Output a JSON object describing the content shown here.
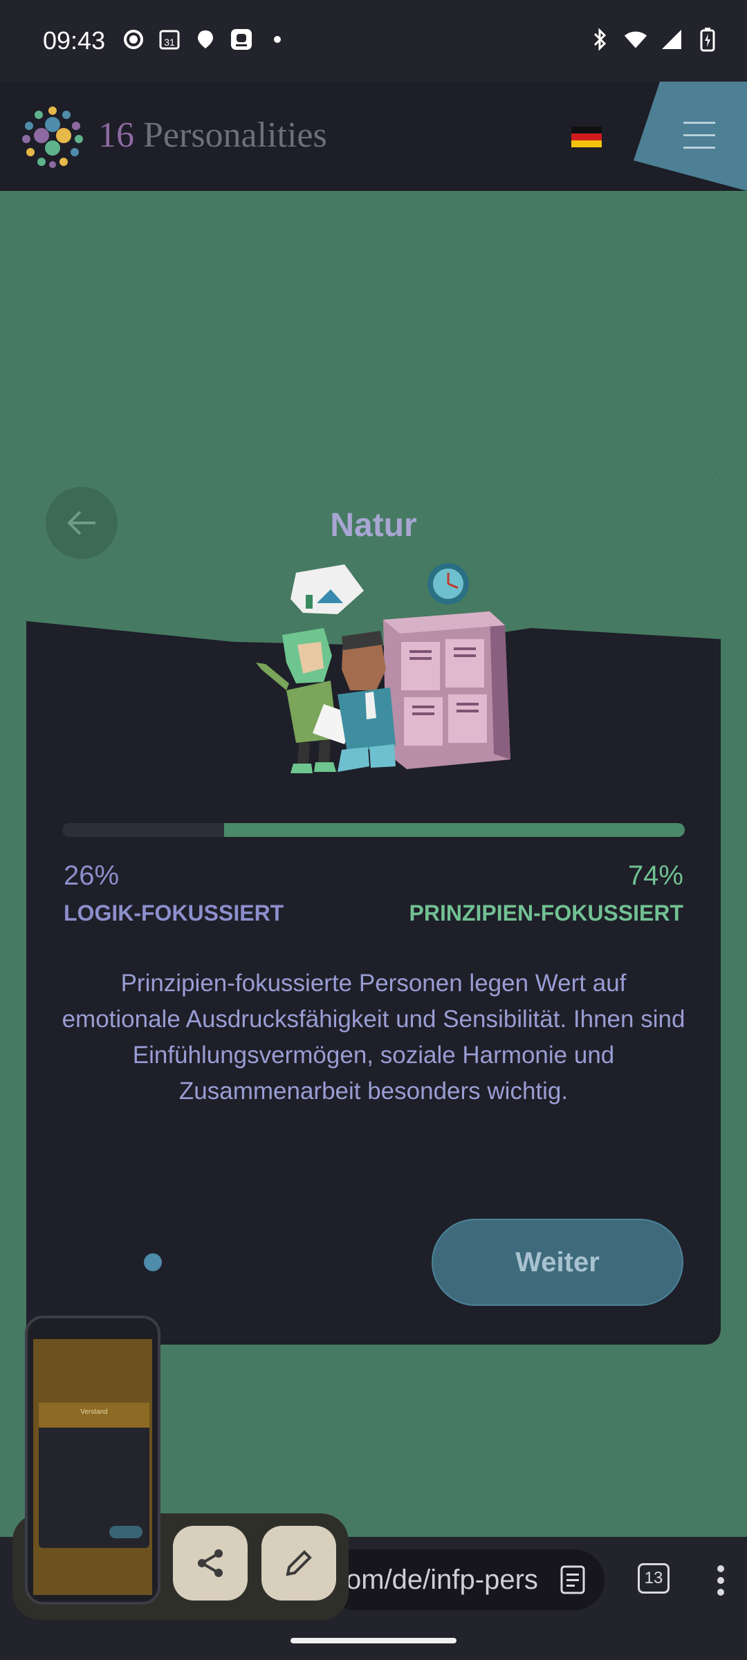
{
  "status_bar": {
    "time": "09:43",
    "left_icons": [
      "chat-bubble-icon",
      "calendar-icon",
      "maps-icon",
      "app-icon",
      "dot-icon"
    ],
    "calendar_day": "31",
    "right_icons": [
      "bluetooth-icon",
      "wifi-icon",
      "signal-icon",
      "battery-charging-icon"
    ]
  },
  "header": {
    "logo_number": "16",
    "logo_word": "Personalities",
    "language_flag": "flag-germany-icon",
    "menu_icon": "hamburger-icon"
  },
  "card": {
    "title": "Natur",
    "back_icon": "arrow-left-icon",
    "progress_fraction_right": 0.74,
    "left_percent": "26%",
    "left_label": "LOGIK-FOKUSSIERT",
    "right_percent": "74%",
    "right_label": "PRINZIPIEN-FOKUSSIERT",
    "description": "Prinzipien-fokussierte Personen legen Wert auf emotionale Ausdrucksfähigkeit und Sensibilität. Ihnen sind Einfühlungsvermögen, soziale Harmonie und Zusammenarbeit besonders wichtig.",
    "next_button": "Weiter"
  },
  "browser": {
    "url": "om/de/infp-pers",
    "tab_count": "13",
    "reader_icon": "reader-mode-icon",
    "overflow_icon": "more-vertical-icon"
  },
  "overlay": {
    "share_icon": "share-icon",
    "edit_icon": "pencil-icon",
    "thumbnail_title": "Verstand"
  },
  "colors": {
    "page_green": "#477a62",
    "card_dark": "#1e1f28",
    "left_accent": "#8c8fcc",
    "right_accent": "#72c193",
    "button": "#3e6a7c"
  }
}
